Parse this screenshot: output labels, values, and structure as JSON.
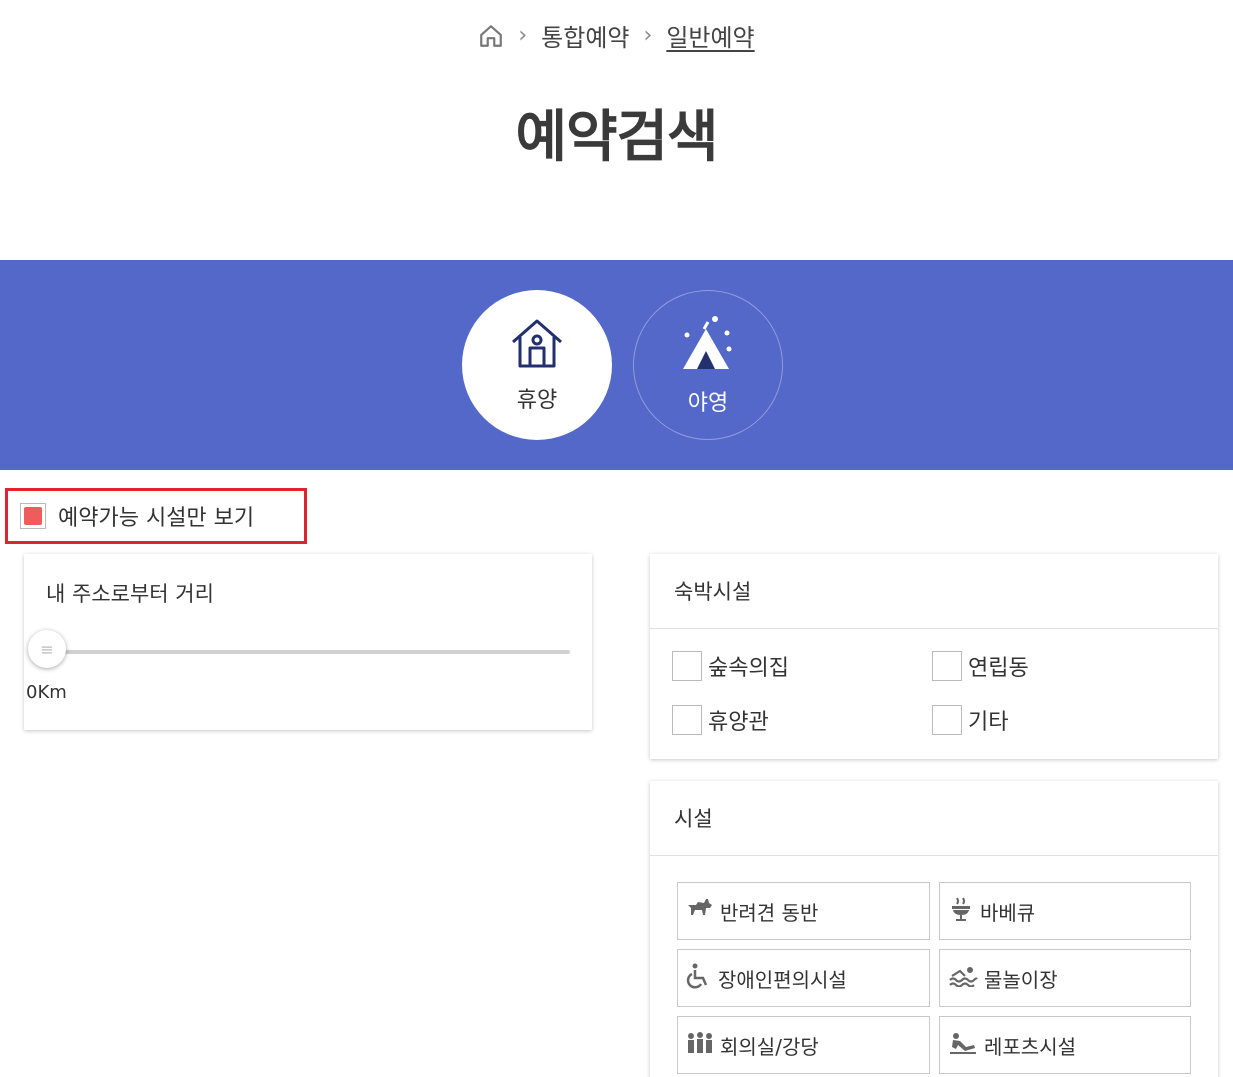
{
  "breadcrumb": {
    "level1": "통합예약",
    "level2": "일반예약"
  },
  "page_title": "예약검색",
  "categories": [
    {
      "label": "휴양",
      "icon": "house-icon",
      "selected": true
    },
    {
      "label": "야영",
      "icon": "tent-icon",
      "selected": false
    }
  ],
  "availability_filter": {
    "label": "예약가능 시설만 보기",
    "checked": true,
    "check_color": "#ee5c5c"
  },
  "distance": {
    "title": "내 주소로부터 거리",
    "value": "0Km"
  },
  "lodging": {
    "title": "숙박시설",
    "options": [
      "숲속의집",
      "연립동",
      "휴양관",
      "기타"
    ]
  },
  "facilities": {
    "title": "시설",
    "items": [
      {
        "label": "반려견 동반",
        "icon": "dog-icon"
      },
      {
        "label": "바베큐",
        "icon": "grill-icon"
      },
      {
        "label": "장애인편의시설",
        "icon": "wheelchair-icon"
      },
      {
        "label": "물놀이장",
        "icon": "swimming-icon"
      },
      {
        "label": "회의실/강당",
        "icon": "meeting-room-icon"
      },
      {
        "label": "레포츠시설",
        "icon": "sports-icon"
      }
    ]
  },
  "colors": {
    "band": "#5468c9",
    "highlight_border": "#e0242f"
  }
}
